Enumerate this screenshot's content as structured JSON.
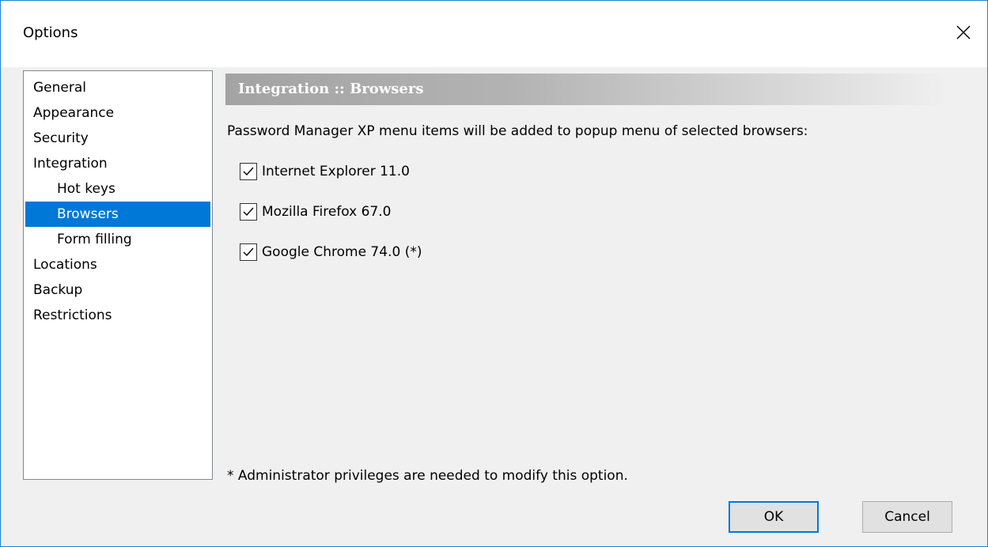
{
  "window": {
    "title": "Options",
    "close_icon": "close-icon"
  },
  "nav": {
    "items": [
      {
        "label": "General",
        "level": 0,
        "selected": false
      },
      {
        "label": "Appearance",
        "level": 0,
        "selected": false
      },
      {
        "label": "Security",
        "level": 0,
        "selected": false
      },
      {
        "label": "Integration",
        "level": 0,
        "selected": false
      },
      {
        "label": "Hot keys",
        "level": 1,
        "selected": false
      },
      {
        "label": "Browsers",
        "level": 1,
        "selected": true
      },
      {
        "label": "Form filling",
        "level": 1,
        "selected": false
      },
      {
        "label": "Locations",
        "level": 0,
        "selected": false
      },
      {
        "label": "Backup",
        "level": 0,
        "selected": false
      },
      {
        "label": "Restrictions",
        "level": 0,
        "selected": false
      }
    ]
  },
  "content": {
    "header": "Integration :: Browsers",
    "description": "Password Manager XP menu items will be added to popup menu of selected browsers:",
    "browsers": [
      {
        "label": "Internet Explorer 11.0",
        "checked": true
      },
      {
        "label": "Mozilla Firefox 67.0",
        "checked": true
      },
      {
        "label": "Google Chrome 74.0 (*)",
        "checked": true
      }
    ],
    "footnote": "* Administrator privileges are needed to modify this option."
  },
  "buttons": {
    "ok": "OK",
    "cancel": "Cancel"
  },
  "colors": {
    "selection": "#0078d7",
    "window_border": "#1883d7",
    "background": "#f0f0f0"
  }
}
